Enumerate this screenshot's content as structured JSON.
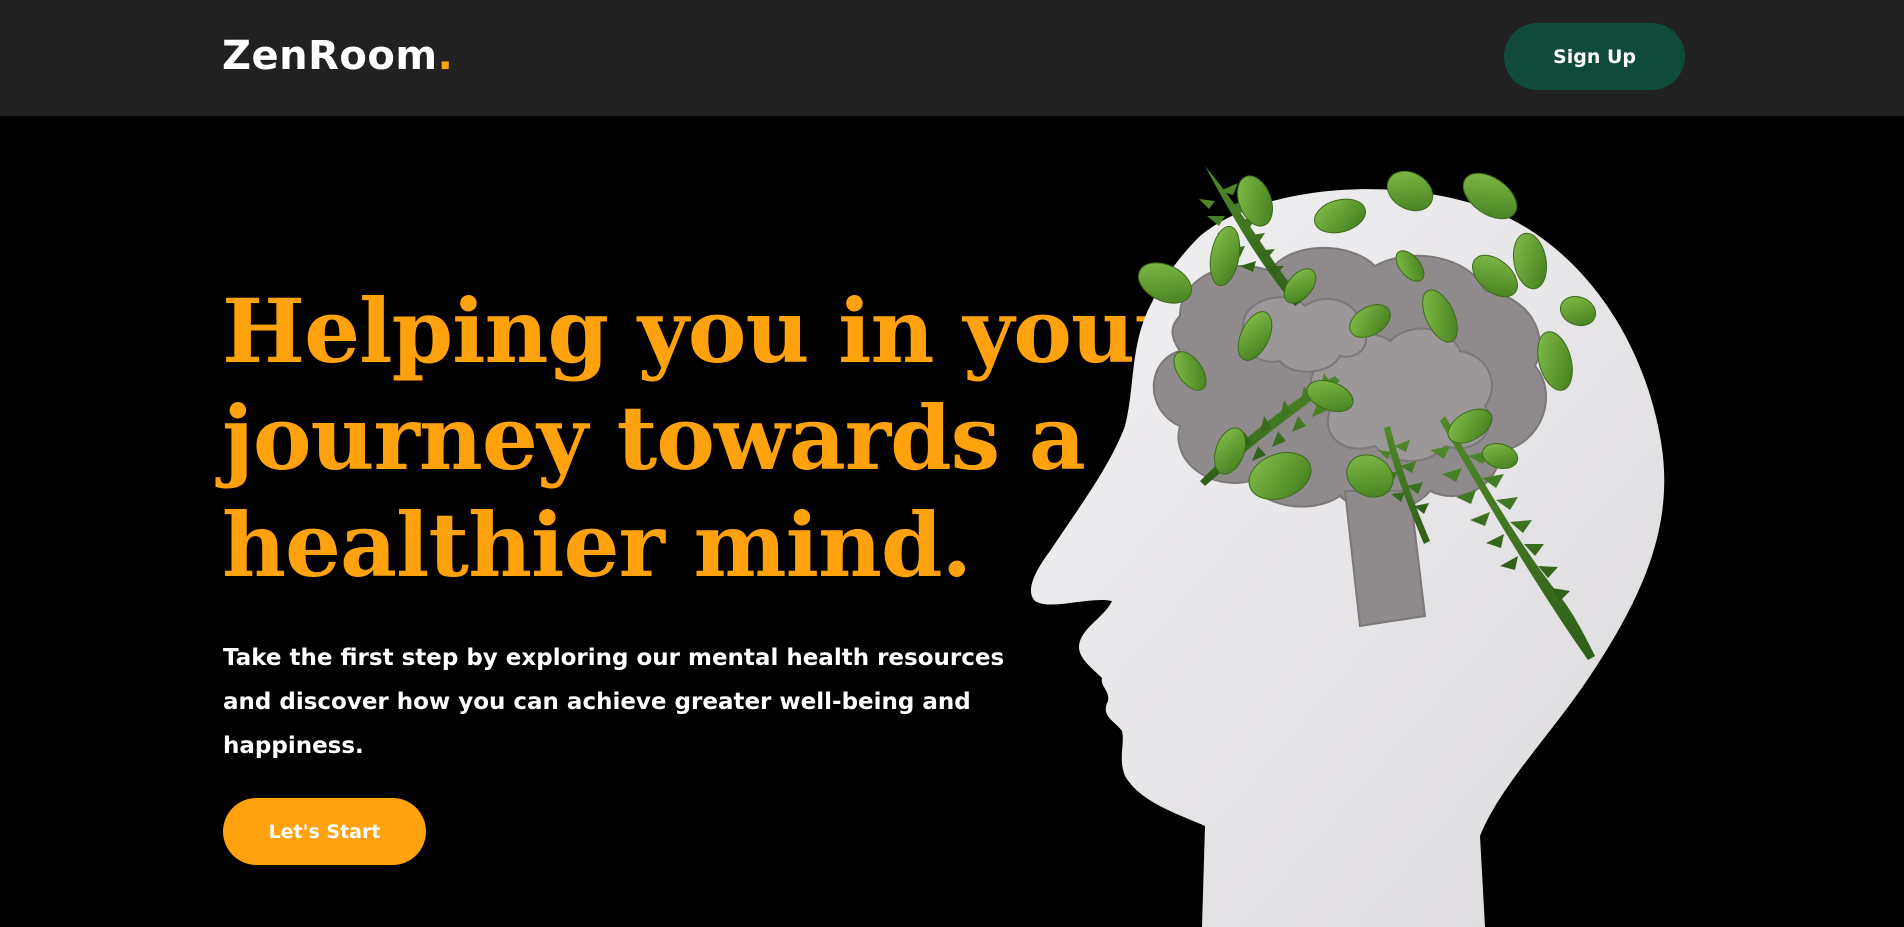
{
  "navbar": {
    "logo_text": "ZenRoom",
    "logo_dot": ".",
    "signup_label": "Sign Up"
  },
  "hero": {
    "headline_lines": [
      "Helping you in your",
      "journey towards a",
      "healthier mind."
    ],
    "subtext_lines": [
      "Take the first step by exploring our mental health resources",
      "and discover how you can achieve greater well-being and",
      "happiness."
    ],
    "cta_label": "Let's Start",
    "illustration": "head-with-leaves-illustration"
  },
  "colors": {
    "accent": "#ffa20d",
    "navbar_bg": "#212121",
    "signup_bg": "#104a3a",
    "page_bg": "#000000",
    "text": "#ffffff",
    "head": "#e9e7ea",
    "paper_brain": "#8f8a8c",
    "leaf": "#5f9a2a"
  }
}
